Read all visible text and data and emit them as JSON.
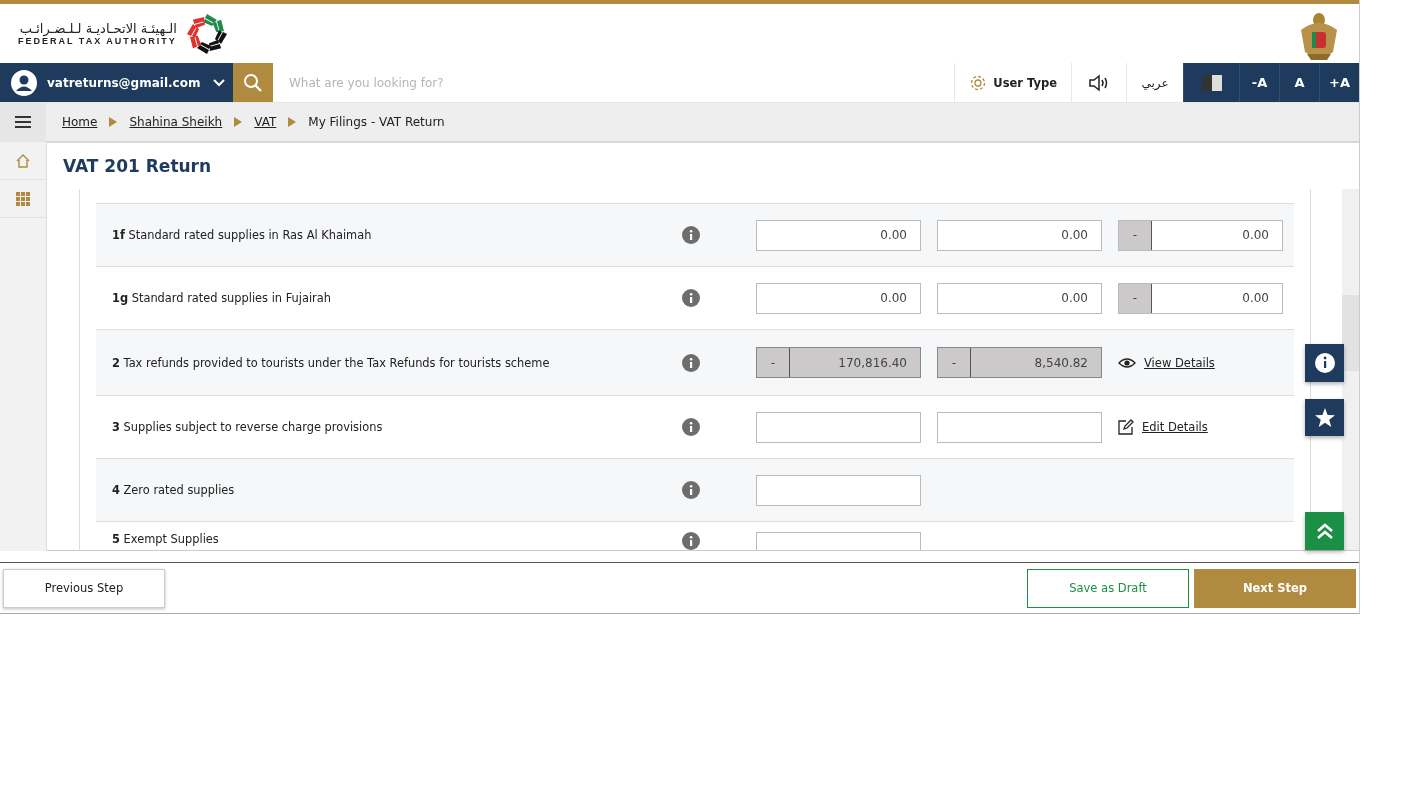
{
  "header": {
    "logo_arabic": "الـهيئـة الاتحـاديـة لـلـضـرائـب",
    "logo_english": "FEDERAL TAX AUTHORITY"
  },
  "navbar": {
    "user_email": "vatreturns@gmail.com",
    "search": {
      "placeholder": "What are you looking for?"
    },
    "user_type": "User Type",
    "language": "عربي",
    "font_buttons": [
      "-A",
      "A",
      "+A"
    ]
  },
  "breadcrumb": [
    {
      "label": "Home",
      "link": true
    },
    {
      "label": "Shahina Sheikh",
      "link": true
    },
    {
      "label": "VAT",
      "link": true
    },
    {
      "label": "My Filings - VAT Return",
      "link": false
    }
  ],
  "page_title": "VAT 201 Return",
  "rows": [
    {
      "label": "**1f** Standard rated supplies in Ras Al Khaimah",
      "fields": [
        {
          "kind": "input",
          "value": "0.00"
        },
        {
          "kind": "input",
          "value": "0.00"
        },
        {
          "kind": "prefixed",
          "prefix": "-",
          "value": "0.00"
        }
      ]
    },
    {
      "label": "**1g** Standard rated supplies in Fujairah",
      "fields": [
        {
          "kind": "input",
          "value": "0.00"
        },
        {
          "kind": "input",
          "value": "0.00"
        },
        {
          "kind": "prefixed",
          "prefix": "-",
          "value": "0.00"
        }
      ]
    },
    {
      "label": "**2** Tax refunds provided to tourists under the Tax Refunds for tourists scheme",
      "fields": [
        {
          "kind": "readonly",
          "prefix": "-",
          "value": "170,816.40"
        },
        {
          "kind": "readonly",
          "prefix": "-",
          "value": "8,540.82"
        }
      ],
      "action": {
        "kind": "view",
        "label": "View Details"
      }
    },
    {
      "label": "**3** Supplies subject to reverse charge provisions",
      "fields": [
        {
          "kind": "input"
        },
        {
          "kind": "input"
        }
      ],
      "action": {
        "kind": "edit",
        "label": "Edit Details"
      }
    },
    {
      "label": "**4** Zero rated supplies",
      "fields": [
        {
          "kind": "input"
        }
      ]
    },
    {
      "label": "**5** Exempt Supplies",
      "fields": [
        {
          "kind": "input"
        }
      ]
    }
  ],
  "footer": {
    "previous": "Previous Step",
    "draft": "Save as Draft",
    "next": "Next Step"
  }
}
